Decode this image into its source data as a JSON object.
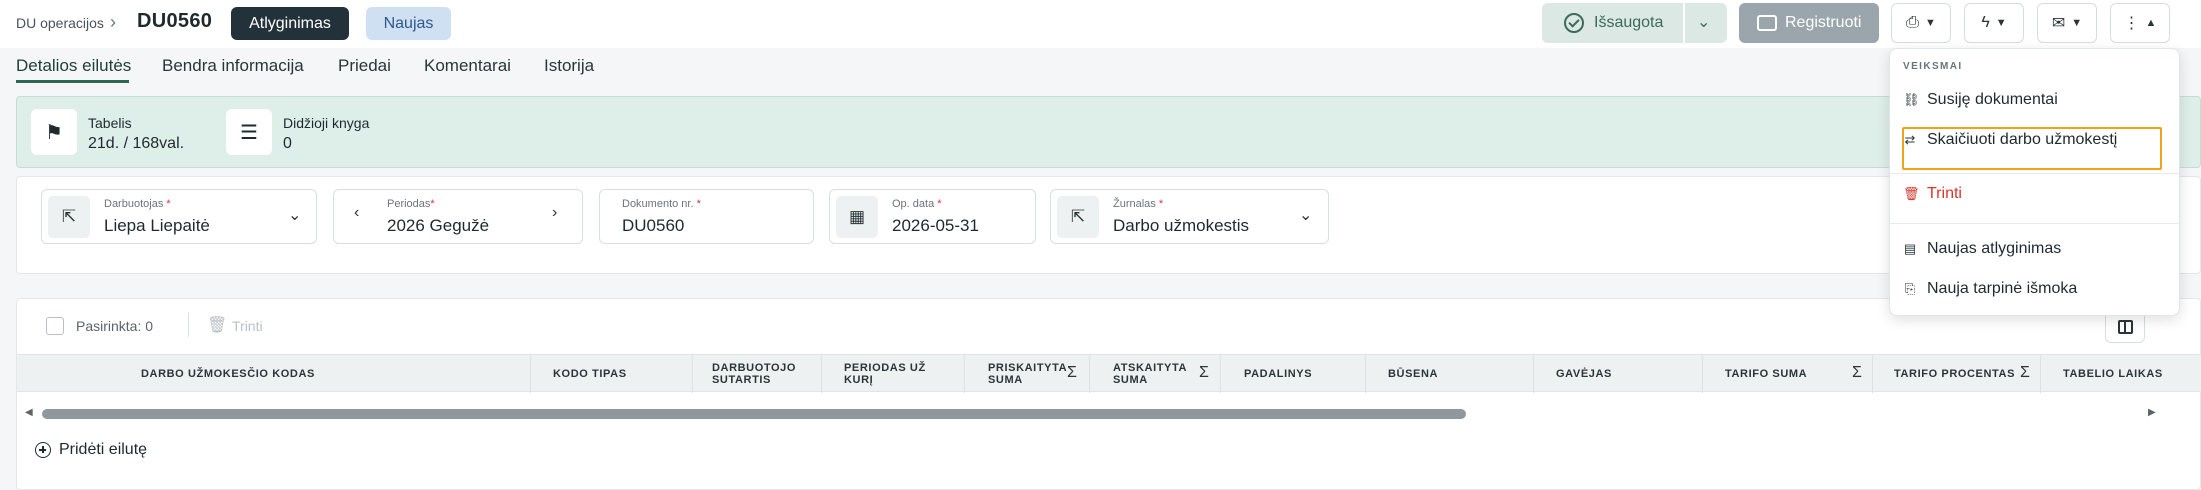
{
  "header": {
    "breadcrumb": "DU operacijos",
    "title": "DU0560",
    "badge_type": "Atlyginimas",
    "badge_status": "Naujas",
    "saved_label": "Išsaugota",
    "register_label": "Registruoti"
  },
  "tabs": [
    "Detalios eilutės",
    "Bendra informacija",
    "Priedai",
    "Komentarai",
    "Istorija"
  ],
  "summary": {
    "tabelis_label": "Tabelis",
    "tabelis_value": "21d. / 168val.",
    "knyga_label": "Didžioji knyga",
    "knyga_value": "0"
  },
  "filters": {
    "employee_label": "Darbuotojas",
    "employee_value": "Liepa Liepaitė",
    "period_label": "Periodas",
    "period_value": "2026 Gegužė",
    "doc_label": "Dokumento nr.",
    "doc_value": "DU0560",
    "date_label": "Op. data",
    "date_value": "2026-05-31",
    "journal_label": "Žurnalas",
    "journal_value": "Darbo užmokestis"
  },
  "table": {
    "selected_label": "Pasirinkta: 0",
    "delete_label": "Trinti",
    "columns": [
      "DARBO UŽMOKESČIO KODAS",
      "KODO TIPAS",
      "DARBUOTOJO SUTARTIS",
      "PERIODAS UŽ KURĮ",
      "PRISKAITYTA SUMA",
      "ATSKAITYTA SUMA",
      "PADALINYS",
      "BŪSENA",
      "GAVĖJAS",
      "TARIFO SUMA",
      "TARIFO PROCENTAS",
      "TABELIO LAIKAS"
    ],
    "add_row_label": "Pridėti eilutę"
  },
  "menu": {
    "header": "VEIKSMAI",
    "items": [
      "Susiję dokumentai",
      "Skaičiuoti darbo užmokestį",
      "Trinti",
      "Naujas atlyginimas",
      "Nauja tarpinė išmoka"
    ]
  },
  "colors": {
    "accent": "#2d6a55",
    "summary_bg": "#deeee8",
    "danger": "#d9342b",
    "highlight": "#f0a21a"
  }
}
